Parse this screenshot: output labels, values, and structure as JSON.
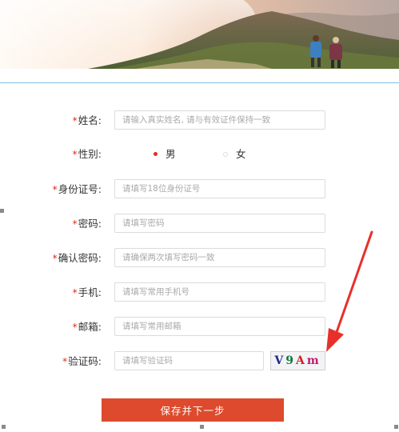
{
  "form": {
    "rows": [
      {
        "key": "name",
        "required_mark": "*",
        "label": "姓名:",
        "placeholder": "请输入真实姓名, 请与有效证件保持一致"
      },
      {
        "key": "gender",
        "required_mark": "*",
        "label": "性别:",
        "options": [
          "男",
          "女"
        ],
        "selected": "男"
      },
      {
        "key": "id",
        "required_mark": "*",
        "label": "身份证号:",
        "placeholder": "请填写18位身份证号"
      },
      {
        "key": "password",
        "required_mark": "*",
        "label": "密码:",
        "placeholder": "请填写密码"
      },
      {
        "key": "confirm",
        "required_mark": "*",
        "label": "确认密码:",
        "placeholder": "请确保两次填写密码一致"
      },
      {
        "key": "phone",
        "required_mark": "*",
        "label": "手机:",
        "placeholder": "请填写常用手机号"
      },
      {
        "key": "email",
        "required_mark": "*",
        "label": "邮箱:",
        "placeholder": "请填写常用邮箱"
      },
      {
        "key": "captcha",
        "required_mark": "*",
        "label": "验证码:",
        "placeholder": "请填写验证码"
      }
    ],
    "captcha_chars": [
      "V",
      "9",
      "A",
      "m"
    ],
    "captcha_colors": [
      "#1c2a8a",
      "#0a7a3a",
      "#d42020",
      "#c21a6a"
    ],
    "submit_label": "保存并下一步"
  },
  "colors": {
    "accent": "#dd4a2d",
    "required": "#e0301e",
    "divider": "#7fbde6",
    "annotation_arrow": "#e8302a"
  }
}
